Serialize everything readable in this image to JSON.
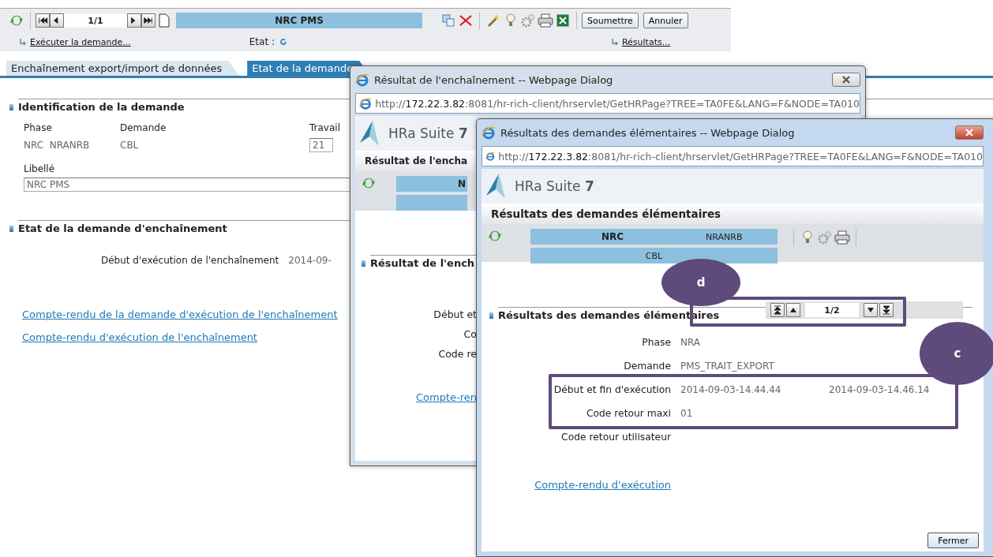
{
  "toolbar": {
    "pager": "1/1",
    "title": "NRC PMS",
    "buttons": [
      "Soumettre",
      "Annuler"
    ],
    "run_link": "Exécuter la demande...",
    "state_label": "Etat :",
    "results_link": "Résultats..."
  },
  "tabs": [
    {
      "label": "Enchaînement export/import de données",
      "selected": false
    },
    {
      "label": "Etat de la demande",
      "selected": true
    }
  ],
  "identification": {
    "title": "Identification de la demande",
    "phase_label": "Phase",
    "phase_value": "NRC  NRANRB",
    "request_label": "Demande",
    "request_value": "CBL",
    "job_label": "Travail",
    "job_value": "21",
    "caption_label": "Libellé",
    "caption_value": "NRC PMS"
  },
  "chain_state": {
    "title": "Etat de la demande d'enchaînement",
    "start_label": "Début d'exécution de l'enchaînement",
    "start_value": "2014-09-",
    "links": [
      "Compte-rendu de la demande d'exécution de l'enchaînement",
      "Compte-rendu d'exécution de l'enchaînement"
    ]
  },
  "chain_dialog": {
    "title": "Résultat de l'enchaînement -- Webpage Dialog",
    "url": "http://**172.22.3.82**:8081/hr-rich-client/hrservlet/GetHRPage?TREE=TA0FE&LANG=F&NODE=TA010",
    "brand": "HRa Suite **7**",
    "heading": "Résultat de l'encha",
    "band_text": "N",
    "section": "Résultat de l'ench",
    "rows": [
      "Début et",
      "Co",
      "Code re"
    ],
    "link": "Compte-ren"
  },
  "results_dialog": {
    "title": "Résultats des demandes élémentaires -- Webpage Dialog",
    "url": "http://**172.22.3.82**:8081/hr-rich-client/hrservlet/GetHRPage?TREE=TA0FE&LANG=F&NODE=TA010",
    "brand": "HRa Suite **7**",
    "heading": "Résultats des demandes élémentaires",
    "band": {
      "phase": "NRC",
      "phase_code": "NRANRB",
      "request": "CBL"
    },
    "section": "Résultats des demandes élémentaires",
    "pager": "1/2",
    "rows": [
      {
        "label": "Phase",
        "values": [
          "NRA"
        ]
      },
      {
        "label": "Demande",
        "values": [
          "PMS_TRAIT_EXPORT"
        ]
      },
      {
        "label": "Début et fin d'exécution",
        "values": [
          "2014-09-03-14.44.44",
          "2014-09-03-14.46.14"
        ]
      },
      {
        "label": "Code retour maxi",
        "values": [
          "01"
        ]
      },
      {
        "label": "Code retour utilisateur",
        "values": []
      }
    ],
    "link": "Compte-rendu d'exécution",
    "close_button": "Fermer"
  },
  "annotations": [
    {
      "label": "d"
    },
    {
      "label": "c"
    }
  ]
}
